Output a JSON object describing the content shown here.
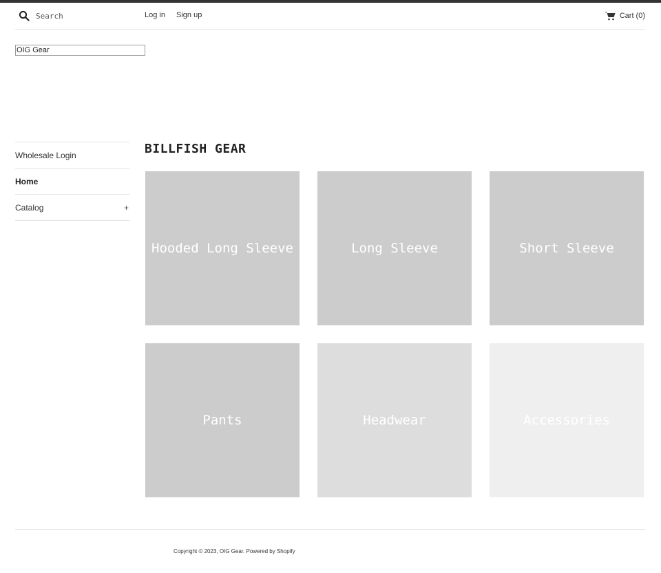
{
  "header": {
    "search_placeholder": "Search",
    "login_label": "Log in",
    "signup_label": "Sign up",
    "cart_label": "Cart (0)"
  },
  "logo_text": "OIG Gear",
  "sidebar": {
    "items": [
      {
        "label": "Wholesale Login"
      },
      {
        "label": "Home"
      },
      {
        "label": "Catalog",
        "expand": "+"
      }
    ]
  },
  "main": {
    "title": "BILLFISH GEAR",
    "collections": [
      {
        "label": "Hooded Long Sleeve",
        "color": "#cccccc"
      },
      {
        "label": "Long Sleeve",
        "color": "#cccccc"
      },
      {
        "label": "Short Sleeve",
        "color": "#cccccc"
      },
      {
        "label": "Pants",
        "color": "#cccccc"
      },
      {
        "label": "Headwear",
        "color": "#dddddd"
      },
      {
        "label": "Accessories",
        "color": "#efefef"
      }
    ]
  },
  "footer": {
    "text": "Copyright © 2023, OIG Gear. Powered by Shopify"
  },
  "colors": {
    "top_bar": "#333333",
    "divider": "#e4e4e4"
  }
}
